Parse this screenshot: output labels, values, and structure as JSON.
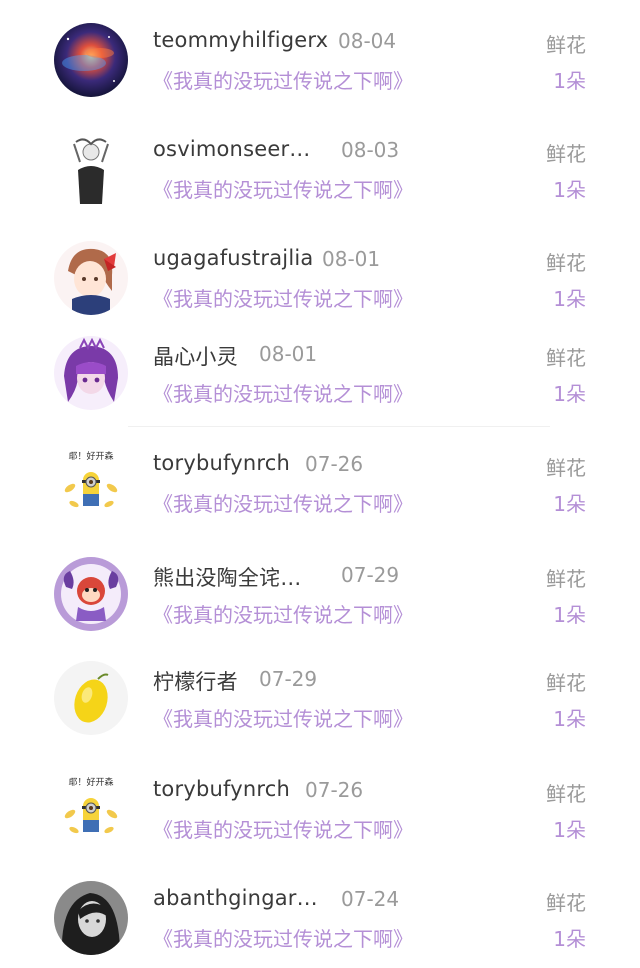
{
  "gifts": [
    {
      "username": "teommyhilfigerx",
      "date": "08-04",
      "work": "《我真的没玩过传说之下啊》",
      "gift": "鲜花",
      "count": "1朵",
      "avatar": "galaxy-avatar"
    },
    {
      "username": "osvimonseer…",
      "date": "08-03",
      "work": "《我真的没玩过传说之下啊》",
      "gift": "鲜花",
      "count": "1朵",
      "avatar": "sketch-woman-avatar"
    },
    {
      "username": "ugagafustrajlia",
      "date": "08-01",
      "work": "《我真的没玩过传说之下啊》",
      "gift": "鲜花",
      "count": "1朵",
      "avatar": "anime-girl-bow-avatar"
    },
    {
      "username": "晶心小灵",
      "date": "08-01",
      "work": "《我真的没玩过传说之下啊》",
      "gift": "鲜花",
      "count": "1朵",
      "avatar": "purple-hair-avatar"
    },
    {
      "username": "torybufynrch",
      "date": "07-26",
      "work": "《我真的没玩过传说之下啊》",
      "gift": "鲜花",
      "count": "1朵",
      "avatar": "minion-avatar",
      "avatar_caption": "耶！好开森"
    },
    {
      "username": "熊出没陶全诧…",
      "date": "07-29",
      "work": "《我真的没玩过传说之下啊》",
      "gift": "鲜花",
      "count": "1朵",
      "avatar": "cartoon-monkey-avatar"
    },
    {
      "username": "柠檬行者",
      "date": "07-29",
      "work": "《我真的没玩过传说之下啊》",
      "gift": "鲜花",
      "count": "1朵",
      "avatar": "lemon-avatar"
    },
    {
      "username": "torybufynrch",
      "date": "07-26",
      "work": "《我真的没玩过传说之下啊》",
      "gift": "鲜花",
      "count": "1朵",
      "avatar": "minion-avatar",
      "avatar_caption": "耶！好开森"
    },
    {
      "username": "abanthgingar…",
      "date": "07-24",
      "work": "《我真的没玩过传说之下啊》",
      "gift": "鲜花",
      "count": "1朵",
      "avatar": "bw-portrait-avatar"
    }
  ],
  "colors": {
    "accent": "#b48fd6",
    "username": "#3a3a3a",
    "muted": "#9a9a9a",
    "background": "#ffffff"
  }
}
